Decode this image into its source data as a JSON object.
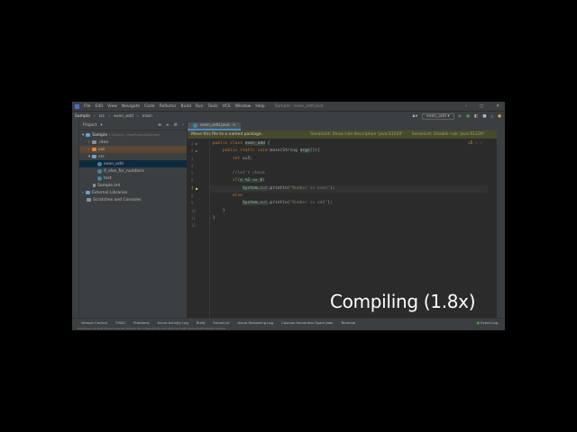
{
  "menu": [
    "File",
    "Edit",
    "View",
    "Navigate",
    "Code",
    "Refactor",
    "Build",
    "Run",
    "Tools",
    "VCS",
    "Window",
    "Help"
  ],
  "window_title": "Sample - even_odd.java",
  "breadcrumb": [
    "Sample",
    "src",
    "even_odd",
    "main"
  ],
  "run_config": "even_odd",
  "project_panel": {
    "title": "Project",
    "items": [
      {
        "label": "Sample",
        "detail": "C:\\Users\\...\\IdeaProjects\\Sample"
      },
      {
        "label": ".idea"
      },
      {
        "label": "out"
      },
      {
        "label": "src"
      },
      {
        "label": "even_odd"
      },
      {
        "label": "if_else_for_numbers"
      },
      {
        "label": "test"
      },
      {
        "label": "Sample.iml"
      },
      {
        "label": "External Libraries"
      },
      {
        "label": "Scratches and Consoles"
      }
    ]
  },
  "editor": {
    "tab": "even_odd.java",
    "notification": "Move this file to a named package.",
    "notif_links": [
      "SonarLint: Show rule description 'java:S1220'",
      "SonarLint: Disable rule 'java:S1220'"
    ],
    "warnings": "5",
    "lines": [
      "1",
      "2",
      "3",
      "4",
      "5",
      "6",
      "7",
      "8",
      "9",
      "10",
      "11",
      "12"
    ]
  },
  "toolwindows": [
    "Version Control",
    "TODO",
    "Problems",
    "Azure Activity Log",
    "Build",
    "SonarLint",
    "Azure Streaming Log",
    "Cosmos Serverless Spark Jobs",
    "Terminal"
  ],
  "event_log": "Event Log",
  "status_text": "Download pre-built shared indexes: Reduce the indexing time and CPU load with pre-built JDK shared indexes",
  "overlay": "Compiling (1.8x)"
}
